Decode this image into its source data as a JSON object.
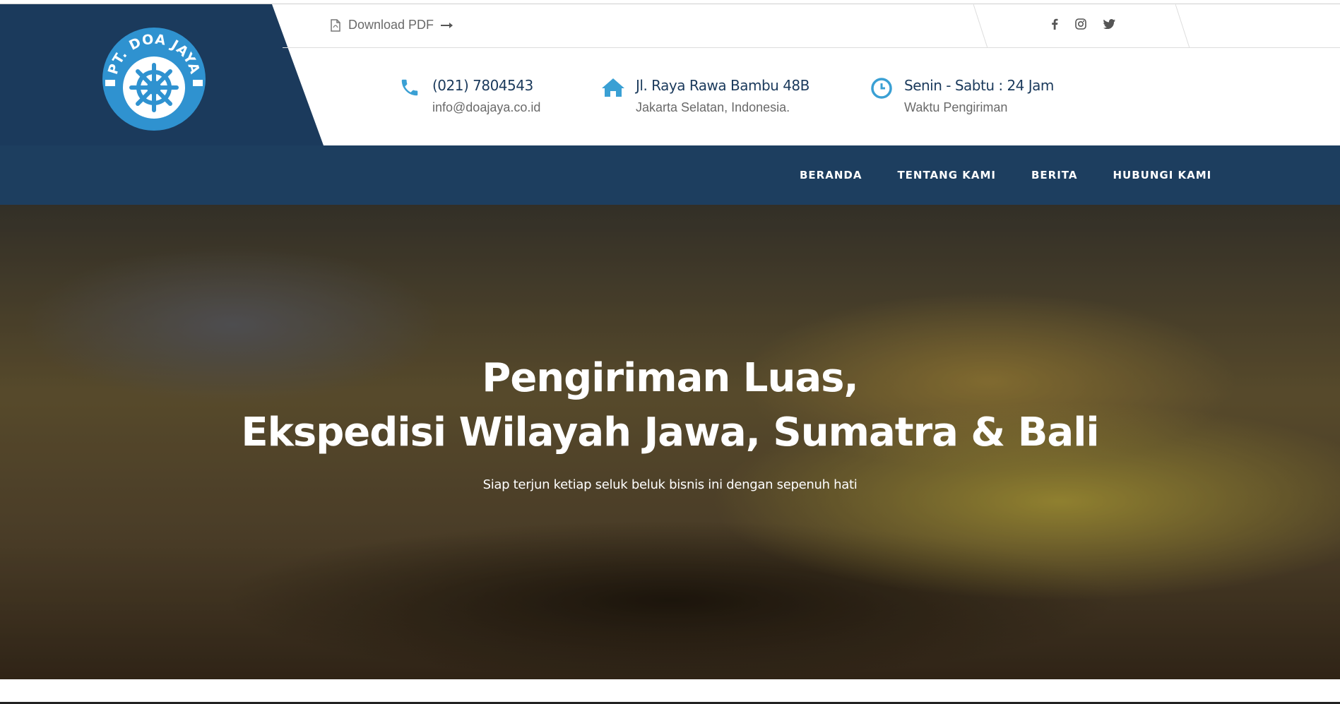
{
  "colors": {
    "brand_dark": "#1b3a5c",
    "accent": "#3aa0d4",
    "nav_bg": "#1d3e5f"
  },
  "topbar": {
    "download_label": "Download PDF",
    "social": [
      "facebook-icon",
      "instagram-icon",
      "twitter-icon"
    ]
  },
  "contacts": [
    {
      "icon": "phone-icon",
      "title": "(021) 7804543",
      "sub": "info@doajaya.co.id"
    },
    {
      "icon": "home-icon",
      "title": "Jl. Raya Rawa Bambu 48B",
      "sub": "Jakarta Selatan, Indonesia."
    },
    {
      "icon": "clock-icon",
      "title": "Senin - Sabtu : 24 Jam",
      "sub": "Waktu Pengiriman"
    }
  ],
  "nav": [
    "BERANDA",
    "TENTANG KAMI",
    "BERITA",
    "HUBUNGI KAMI"
  ],
  "hero": {
    "line1": "Pengiriman Luas,",
    "line2": "Ekspedisi Wilayah Jawa, Sumatra & Bali",
    "subtitle": "Siap terjun ketiap seluk beluk bisnis ini dengan sepenuh hati"
  },
  "logo_text": "PT. DOA JAYA"
}
